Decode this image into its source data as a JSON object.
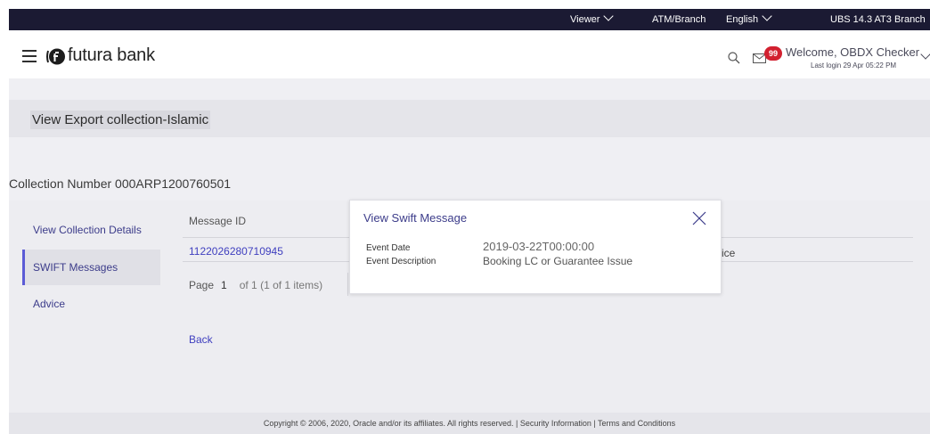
{
  "topbar": {
    "viewer_label": "Viewer",
    "atm_label": "ATM/Branch",
    "language_label": "English",
    "branch_label": "UBS 14.3 AT3 Branch"
  },
  "header": {
    "brand": "futura bank",
    "notification_count": "99",
    "welcome": "Welcome, OBDX Checker",
    "last_login": "Last login 29 Apr 05:22 PM"
  },
  "page": {
    "title": "View Export collection-Islamic",
    "collection_number": "Collection Number 000ARP1200760501"
  },
  "sidebar": {
    "items": [
      {
        "label": "View Collection Details"
      },
      {
        "label": "SWIFT Messages"
      },
      {
        "label": "Advice"
      }
    ]
  },
  "table": {
    "header_message_id": "Message ID",
    "row_message_id": "1122026280710945",
    "row_tail": "ice"
  },
  "pagination": {
    "page_label": "Page",
    "page_number": "1",
    "of_text": "of 1  (1 of 1 items)"
  },
  "back_label": "Back",
  "modal": {
    "title": "View Swift Message",
    "event_date_label": "Event Date",
    "event_date_value": "2019-03-22T00:00:00",
    "event_description_label": "Event Description",
    "event_description_value": "Booking LC or Guarantee Issue"
  },
  "footer": {
    "text": "Copyright © 2006, 2020, Oracle and/or its affiliates. All rights reserved. | Security Information | Terms and Conditions"
  },
  "colors": {
    "topbar_bg": "#1b1a33",
    "link": "#3f3fbf",
    "badge": "#d2202f",
    "accent": "#5b5bd6"
  }
}
